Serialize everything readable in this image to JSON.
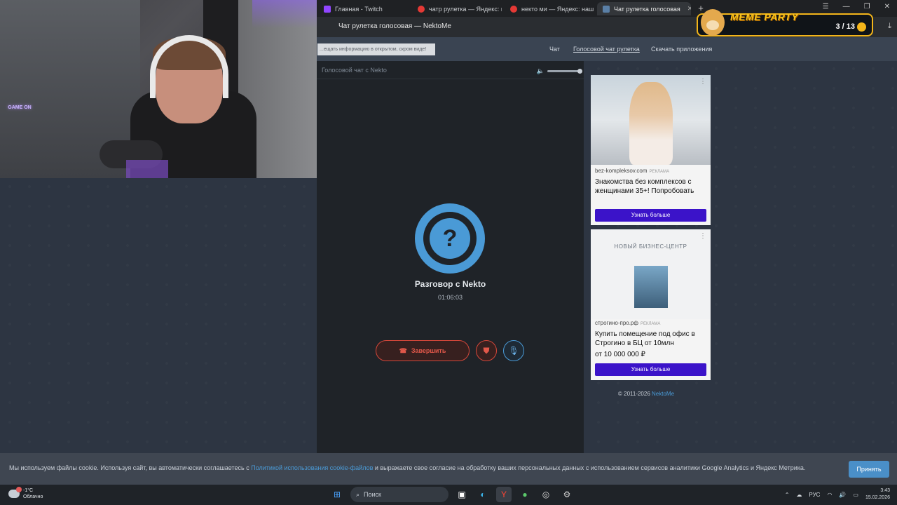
{
  "browser": {
    "tabs": [
      {
        "label": "Главная - Twitch",
        "color": "#9146ff"
      },
      {
        "label": "чатр рулетка — Яндекс: н",
        "color": "#e53935"
      },
      {
        "label": "некто ми — Яндекс: наш",
        "color": "#e53935"
      },
      {
        "label": "Чат рулетка голосовая",
        "color": "#5a7fa6",
        "active": true
      }
    ],
    "window_title": "Чат рулетка голосовая — NektoMe"
  },
  "site": {
    "notice": "...ещать информацию в открытом, скром виде!",
    "nav": [
      "Чат",
      "Голосовой чат рулетка",
      "Скачать приложения"
    ]
  },
  "chat": {
    "header": "Голосовой чат с Nekto",
    "avatar_symbol": "?",
    "conversation_title": "Разговор с Nekto",
    "timer": "01:06:03",
    "end_label": "Завершить"
  },
  "ads": [
    {
      "domain": "bez-kompleksov.com",
      "tag": "РЕКЛАМА",
      "headline": "Знакомства без комплексов с женщинами 35+! Попробовать",
      "cta": "Узнать больше"
    },
    {
      "image_heading": "НОВЫЙ БИЗНЕС-ЦЕНТР",
      "domain": "строгино-про.рф",
      "tag": "РЕКЛАМА",
      "headline": "Купить помещение под офис в Строгино в БЦ от 10млн",
      "price": "от 10 000 000 ₽",
      "cta": "Узнать больше"
    }
  ],
  "footer": {
    "copyright": "© 2011-2026",
    "brand": "NektoMe"
  },
  "cookie": {
    "text_before": "Мы используем файлы cookie. Используя сайт, вы автоматически соглашаетесь с",
    "link": "Политикой использования cookie-файлов",
    "text_after": "и выражаете свое согласие на обработку ваших персональных данных с использованием сервисов аналитики Google Analytics и Яндекс Метрика.",
    "accept": "Принять"
  },
  "taskbar": {
    "temperature": "-1°C",
    "weather": "Облачно",
    "search": "Поиск",
    "lang": "РУС",
    "time": "3:43",
    "date": "15.02.2026"
  },
  "overlay": {
    "title": "MEME PARTY",
    "count": "3 / 13"
  },
  "webcam": {
    "neon_text": "GAME ON"
  }
}
